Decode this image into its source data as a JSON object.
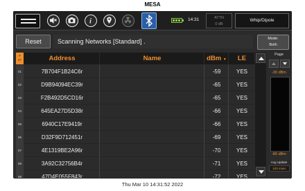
{
  "window_title": "MESA",
  "footer_timestamp": "Thu Mar 10 14:31:52 2022",
  "toolbar": {
    "icons": [
      "menu-icon",
      "mute-icon",
      "camera-icon",
      "info-icon",
      "location-pin-icon",
      "radiation-icon",
      "bluetooth-icon"
    ],
    "time": "14:31",
    "attn_label": "ATTN",
    "attn_value": "0 dB",
    "antenna": "Whip/Dipole"
  },
  "controls": {
    "reset_label": "Reset",
    "status_text": "Scanning Networks [Standard] .",
    "mode_label": "Mode:",
    "mode_value": "Both"
  },
  "table": {
    "sort_indicator_top": "#",
    "sort_indicator_bottom": "27",
    "columns": [
      "Address",
      "Name",
      "dBm",
      "LE"
    ],
    "sort_arrow": "▼",
    "rows": [
      {
        "num": "01",
        "address": "7B704F1B24C6r",
        "name": "",
        "dbm": "-59",
        "le": "YES"
      },
      {
        "num": "02",
        "address": "D9B94094EC39r",
        "name": "",
        "dbm": "-65",
        "le": "YES"
      },
      {
        "num": "03",
        "address": "F2B492D5CD16r",
        "name": "",
        "dbm": "-65",
        "le": "YES"
      },
      {
        "num": "04",
        "address": "645EA27D5D38r",
        "name": "",
        "dbm": "-66",
        "le": "YES"
      },
      {
        "num": "05",
        "address": "6940C17E9419r",
        "name": "",
        "dbm": "-66",
        "le": "YES"
      },
      {
        "num": "06",
        "address": "D32F9D712451r",
        "name": "",
        "dbm": "-69",
        "le": "YES"
      },
      {
        "num": "07",
        "address": "4E1319BE2A96r",
        "name": "",
        "dbm": "-70",
        "le": "YES"
      },
      {
        "num": "08",
        "address": "3A92C32756B4r",
        "name": "",
        "dbm": "-71",
        "le": "YES"
      },
      {
        "num": "09",
        "address": "47D4E055F843r",
        "name": "",
        "dbm": "-72",
        "le": "YES"
      }
    ]
  },
  "side_panel": {
    "page_label": "Page",
    "level_top": "-30 dBm",
    "level_bottom": "-80 dBm",
    "avg_label": "Avg Update",
    "avg_value": "100 msec"
  },
  "colors": {
    "accent": "#f0902c",
    "background": "#2b2b2b",
    "bluetooth_active": "#2a5fa8",
    "battery": "#8acc46"
  }
}
